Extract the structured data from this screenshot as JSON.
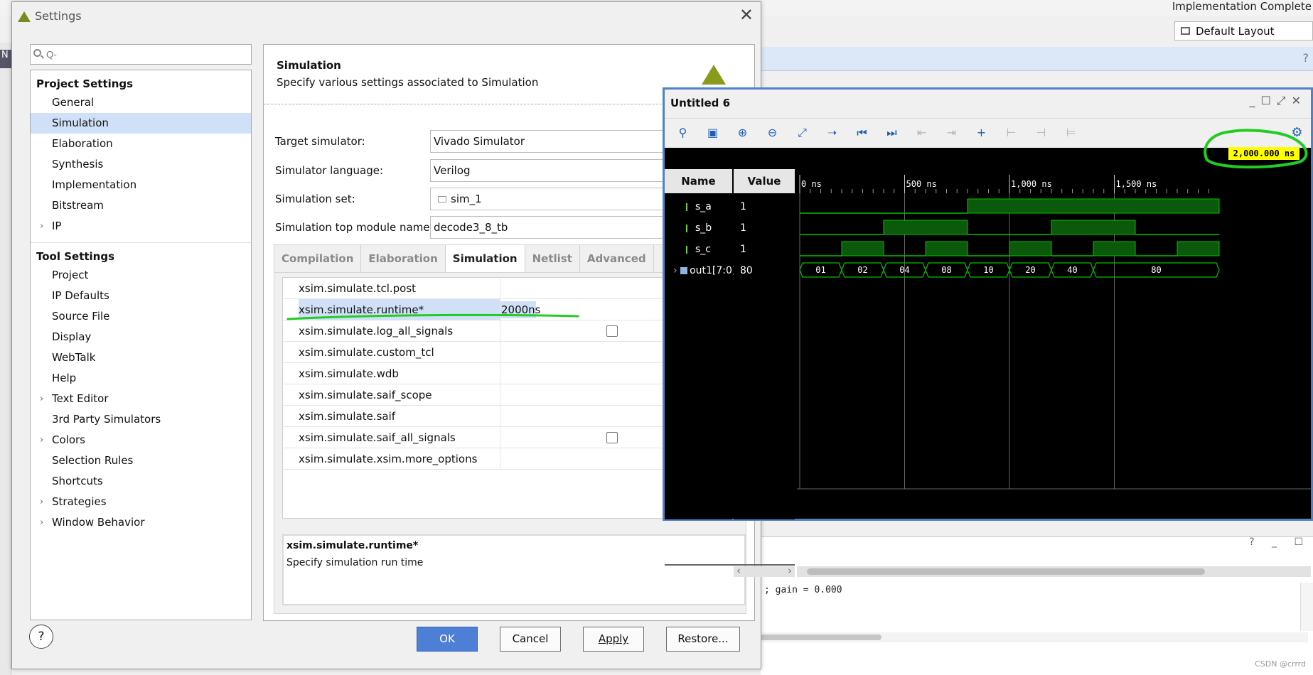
{
  "background": {
    "status": "Implementation Complete",
    "layout_select": "Default Layout",
    "left_tab_letter": "N",
    "console_text": "; gain = 0.000",
    "watermark": "CSDN @crrrd"
  },
  "dialog": {
    "title": "Settings",
    "search_placeholder": "Q-",
    "project_settings_header": "Project Settings",
    "project_items": [
      {
        "label": "General",
        "expandable": false
      },
      {
        "label": "Simulation",
        "expandable": false,
        "selected": true
      },
      {
        "label": "Elaboration",
        "expandable": false
      },
      {
        "label": "Synthesis",
        "expandable": false
      },
      {
        "label": "Implementation",
        "expandable": false
      },
      {
        "label": "Bitstream",
        "expandable": false
      },
      {
        "label": "IP",
        "expandable": true
      }
    ],
    "tool_settings_header": "Tool Settings",
    "tool_items": [
      {
        "label": "Project",
        "expandable": false
      },
      {
        "label": "IP Defaults",
        "expandable": false
      },
      {
        "label": "Source File",
        "expandable": false
      },
      {
        "label": "Display",
        "expandable": false
      },
      {
        "label": "WebTalk",
        "expandable": false
      },
      {
        "label": "Help",
        "expandable": false
      },
      {
        "label": "Text Editor",
        "expandable": true
      },
      {
        "label": "3rd Party Simulators",
        "expandable": false
      },
      {
        "label": "Colors",
        "expandable": true
      },
      {
        "label": "Selection Rules",
        "expandable": false
      },
      {
        "label": "Shortcuts",
        "expandable": false
      },
      {
        "label": "Strategies",
        "expandable": true
      },
      {
        "label": "Window Behavior",
        "expandable": true
      }
    ],
    "panel": {
      "title": "Simulation",
      "description": "Specify various settings associated to Simulation",
      "fields": [
        {
          "label": "Target simulator:",
          "value": "Vivado Simulator"
        },
        {
          "label": "Simulator language:",
          "value": "Verilog"
        },
        {
          "label": "Simulation set:",
          "value": "sim_1"
        },
        {
          "label": "Simulation top module name:",
          "value": "decode3_8_tb"
        }
      ],
      "tabs": [
        "Compilation",
        "Elaboration",
        "Simulation",
        "Netlist",
        "Advanced"
      ],
      "active_tab": "Simulation",
      "properties": [
        {
          "name": "xsim.simulate.tcl.post",
          "value": "",
          "checkbox": false
        },
        {
          "name": "xsim.simulate.runtime*",
          "value": "2000ns",
          "checkbox": false,
          "selected": true
        },
        {
          "name": "xsim.simulate.log_all_signals",
          "value": "",
          "checkbox": true
        },
        {
          "name": "xsim.simulate.custom_tcl",
          "value": "",
          "checkbox": false
        },
        {
          "name": "xsim.simulate.wdb",
          "value": "",
          "checkbox": false
        },
        {
          "name": "xsim.simulate.saif_scope",
          "value": "",
          "checkbox": false
        },
        {
          "name": "xsim.simulate.saif",
          "value": "",
          "checkbox": false
        },
        {
          "name": "xsim.simulate.saif_all_signals",
          "value": "",
          "checkbox": true
        },
        {
          "name": "xsim.simulate.xsim.more_options",
          "value": "",
          "checkbox": false
        }
      ],
      "desc_name": "xsim.simulate.runtime*",
      "desc_text": "Specify simulation run time"
    },
    "buttons": {
      "ok": "OK",
      "cancel": "Cancel",
      "apply": "Apply",
      "restore": "Restore...",
      "help": "?"
    }
  },
  "wave": {
    "title": "Untitled 6",
    "cursor_value": "2,000.000 ns",
    "name_header": "Name",
    "value_header": "Value",
    "time_labels": [
      "0 ns",
      "500 ns",
      "1,000 ns",
      "1,500 ns"
    ],
    "signals": [
      {
        "name": "s_a",
        "value": "1",
        "type": "bit"
      },
      {
        "name": "s_b",
        "value": "1",
        "type": "bit"
      },
      {
        "name": "s_c",
        "value": "1",
        "type": "bit"
      },
      {
        "name": "out1[7:0]",
        "value": "80",
        "type": "bus"
      }
    ],
    "bus_values": [
      "01",
      "02",
      "04",
      "08",
      "10",
      "20",
      "40",
      "80"
    ],
    "colors": {
      "wave_green": "#00c000",
      "background": "#000000",
      "cursor": "#ffff00",
      "annotation": "#22dd22"
    }
  }
}
